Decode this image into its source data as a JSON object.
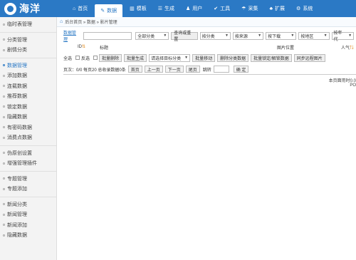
{
  "app": {
    "logo_text": "海洋"
  },
  "nav": [
    {
      "icon": "⌂",
      "label": "首页",
      "active": false
    },
    {
      "icon": "✎",
      "label": "数据",
      "active": true
    },
    {
      "icon": "▥",
      "label": "模板",
      "active": false
    },
    {
      "icon": "☰",
      "label": "生成",
      "active": false
    },
    {
      "icon": "♟",
      "label": "用户",
      "active": false
    },
    {
      "icon": "✔",
      "label": "工具",
      "active": false
    },
    {
      "icon": "☂",
      "label": "采集",
      "active": false
    },
    {
      "icon": "♣",
      "label": "扩展",
      "active": false
    },
    {
      "icon": "⚙",
      "label": "系统",
      "active": false
    }
  ],
  "sidebar": {
    "groups": [
      [
        "临时表管理"
      ],
      [
        "分类管理",
        "剧情分类"
      ],
      [
        "数据管理",
        "添加数据",
        "连载数据",
        "推荐数据",
        "锁定数据",
        "隐藏数据",
        "有密码数据",
        "消费点数据"
      ],
      [
        "伪原创设置",
        "增强管理插件"
      ],
      [
        "专题管理",
        "专题添加"
      ],
      [
        "新闻分类",
        "新闻管理",
        "新闻添加",
        "隐藏数据"
      ]
    ],
    "active": "数据管理"
  },
  "breadcrumb": "后台首页 » 数据 » 影片管理",
  "filter": {
    "label": "数据管理",
    "search_value": "",
    "category": "全部分类",
    "query_button": "查询或重置",
    "sort_category": "按分类",
    "sort_source": "按来源",
    "sort_download": "按下载",
    "sort_region": "按地区",
    "sort_year": "按年代"
  },
  "table": {
    "columns": [
      {
        "label": "ID",
        "sort": "⇅"
      },
      {
        "label": "标题",
        "sort": ""
      },
      {
        "label": "图片位置",
        "sort": ""
      },
      {
        "label": "人气",
        "sort": "⇅"
      }
    ]
  },
  "actions": {
    "select_all": "全选",
    "invert": "反选",
    "batch_delete": "批量删除",
    "batch_generate": "批量生成",
    "target_category": "请选择目标分类",
    "batch_move": "批量移动",
    "delete_category_data": "删除分类数据",
    "batch_lock_unlock": "批量锁定/解锁数据",
    "sync_images": "同步远程图片"
  },
  "pagination": {
    "info": "页次：0/0 每页20 总收录数据0条",
    "first": "首页",
    "prev": "上一页",
    "next": "下一页",
    "last": "尾页",
    "jump_label": "跳转",
    "jump_value": "",
    "confirm": "确 定"
  },
  "footer": {
    "line1": "本页面用时0.0",
    "line2": "PO"
  },
  "colors": {
    "brand": "#2b79c5",
    "sort_icon": "#e08a1e"
  }
}
